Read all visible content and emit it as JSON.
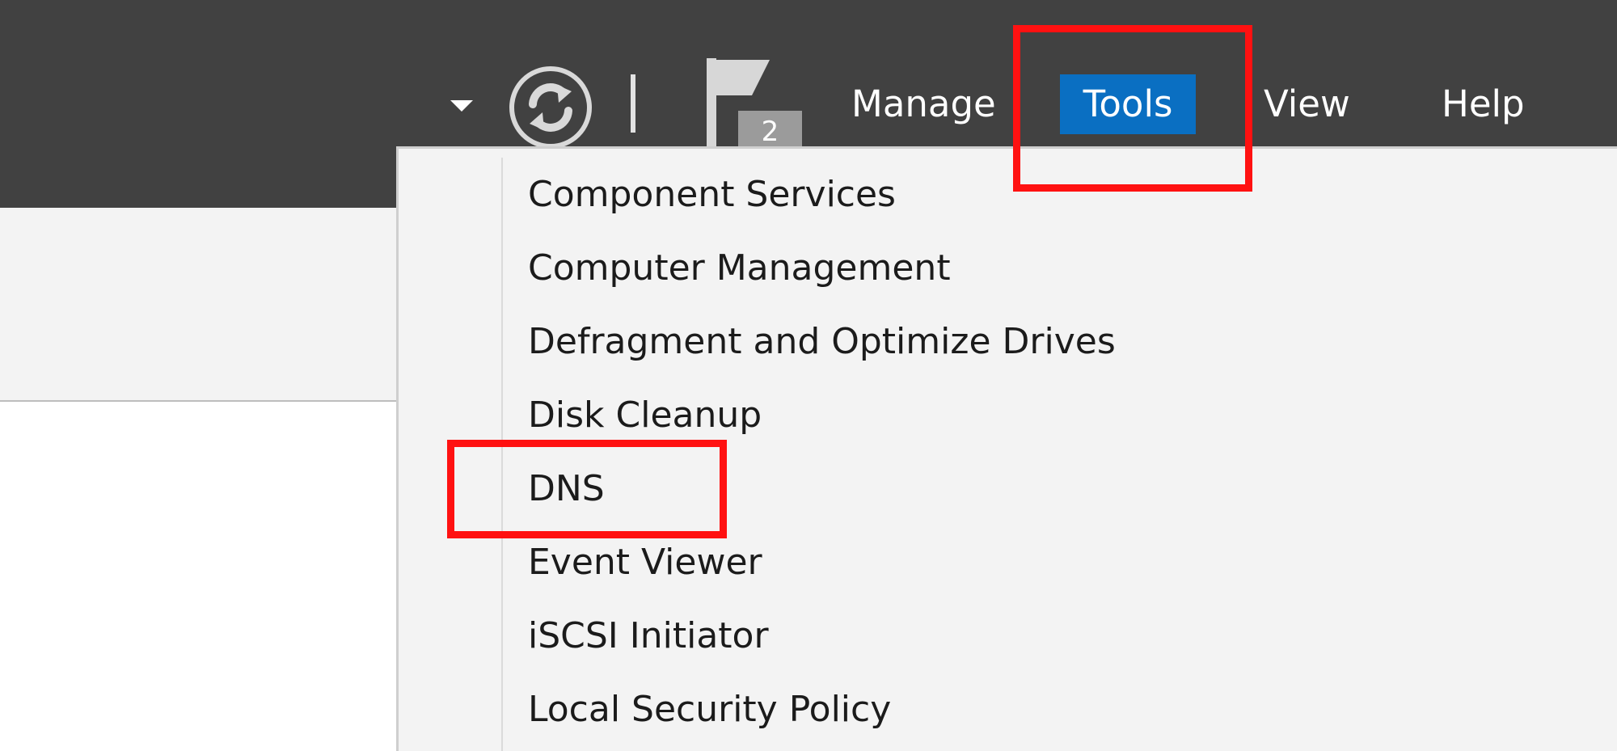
{
  "menubar": {
    "items": [
      "Manage",
      "Tools",
      "View",
      "Help"
    ],
    "active": "Tools"
  },
  "toolbar": {
    "icons": [
      "chevron-down-icon",
      "refresh-icon",
      "separator",
      "flag-icon"
    ],
    "notification_count": "2"
  },
  "tools_menu": {
    "items": [
      "Component Services",
      "Computer Management",
      "Defragment and Optimize Drives",
      "Disk Cleanup",
      "DNS",
      "Event Viewer",
      "iSCSI Initiator",
      "Local Security Policy"
    ]
  },
  "annotations": {
    "highlight_color": "#ff1111",
    "highlighted": [
      "Tools",
      "DNS"
    ]
  },
  "colors": {
    "titlebar_bg": "#414141",
    "active_menu_bg": "#0a6fc2",
    "menu_bg": "#f3f3f3"
  }
}
